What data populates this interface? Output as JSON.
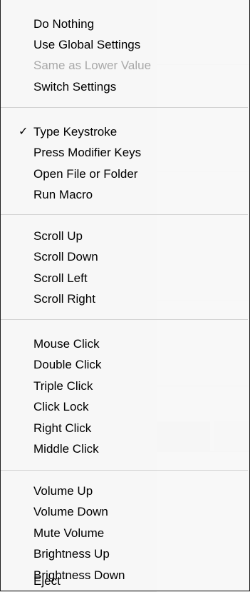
{
  "menu": {
    "groups": [
      {
        "items": [
          {
            "label": "Do Nothing",
            "checked": false,
            "enabled": true
          },
          {
            "label": "Use Global Settings",
            "checked": false,
            "enabled": true
          },
          {
            "label": "Same as Lower Value",
            "checked": false,
            "enabled": false
          },
          {
            "label": "Switch Settings",
            "checked": false,
            "enabled": true
          }
        ]
      },
      {
        "items": [
          {
            "label": "Type Keystroke",
            "checked": true,
            "enabled": true
          },
          {
            "label": "Press Modifier Keys",
            "checked": false,
            "enabled": true
          },
          {
            "label": "Open File or Folder",
            "checked": false,
            "enabled": true
          },
          {
            "label": "Run Macro",
            "checked": false,
            "enabled": true
          }
        ]
      },
      {
        "items": [
          {
            "label": "Scroll Up",
            "checked": false,
            "enabled": true
          },
          {
            "label": "Scroll Down",
            "checked": false,
            "enabled": true
          },
          {
            "label": "Scroll Left",
            "checked": false,
            "enabled": true
          },
          {
            "label": "Scroll Right",
            "checked": false,
            "enabled": true
          }
        ]
      },
      {
        "items": [
          {
            "label": "Mouse Click",
            "checked": false,
            "enabled": true
          },
          {
            "label": "Double Click",
            "checked": false,
            "enabled": true
          },
          {
            "label": "Triple Click",
            "checked": false,
            "enabled": true
          },
          {
            "label": "Click Lock",
            "checked": false,
            "enabled": true
          },
          {
            "label": "Right Click",
            "checked": false,
            "enabled": true
          },
          {
            "label": "Middle Click",
            "checked": false,
            "enabled": true
          }
        ]
      },
      {
        "items": [
          {
            "label": "Volume Up",
            "checked": false,
            "enabled": true
          },
          {
            "label": "Volume Down",
            "checked": false,
            "enabled": true
          },
          {
            "label": "Mute Volume",
            "checked": false,
            "enabled": true
          },
          {
            "label": "Brightness Up",
            "checked": false,
            "enabled": true
          },
          {
            "label": "Brightness Down",
            "checked": false,
            "enabled": true
          },
          {
            "label": "Eject",
            "checked": false,
            "enabled": true
          }
        ]
      }
    ],
    "check_glyph": "✓"
  }
}
